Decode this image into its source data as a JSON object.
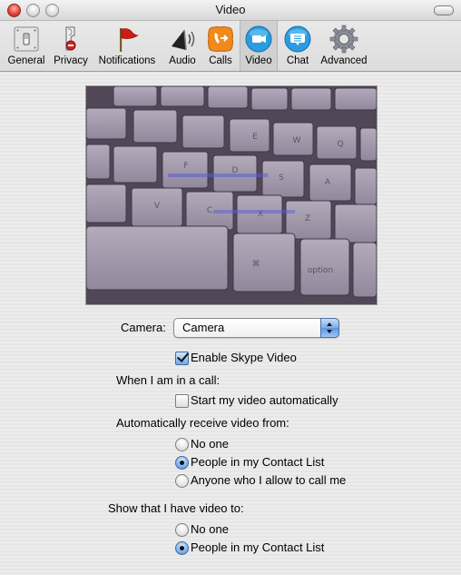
{
  "window": {
    "title": "Video"
  },
  "toolbar": {
    "items": [
      {
        "label": "General",
        "icon": "light-switch-icon",
        "selected": false
      },
      {
        "label": "Privacy",
        "icon": "do-not-disturb-sign-icon",
        "selected": false
      },
      {
        "label": "Notifications",
        "icon": "red-flag-icon",
        "selected": false
      },
      {
        "label": "Audio",
        "icon": "speaker-icon",
        "selected": false
      },
      {
        "label": "Calls",
        "icon": "phone-forward-icon",
        "selected": false
      },
      {
        "label": "Video",
        "icon": "video-camera-icon",
        "selected": true
      },
      {
        "label": "Chat",
        "icon": "chat-bubble-icon",
        "selected": false
      },
      {
        "label": "Advanced",
        "icon": "gear-icon",
        "selected": false
      }
    ]
  },
  "preview": {
    "description": "Live camera preview showing a laptop keyboard"
  },
  "camera": {
    "label": "Camera:",
    "selected": "Camera"
  },
  "enable_video": {
    "label": "Enable Skype Video",
    "checked": true
  },
  "in_call": {
    "heading": "When I am in a call:",
    "start_auto": {
      "label": "Start my video automatically",
      "checked": false
    }
  },
  "receive_from": {
    "heading": "Automatically receive video from:",
    "options": [
      {
        "label": "No one",
        "selected": false
      },
      {
        "label": "People in my Contact List",
        "selected": true
      },
      {
        "label": "Anyone who I allow to call me",
        "selected": false
      }
    ]
  },
  "show_to": {
    "heading": "Show that I have video to:",
    "options": [
      {
        "label": "No one",
        "selected": false
      },
      {
        "label": "People in my Contact List",
        "selected": true
      }
    ]
  },
  "colors": {
    "accent_blue": "#4a86d4",
    "selected_tab_bg": "#d0d0d0",
    "close_red": "#e8453c"
  }
}
